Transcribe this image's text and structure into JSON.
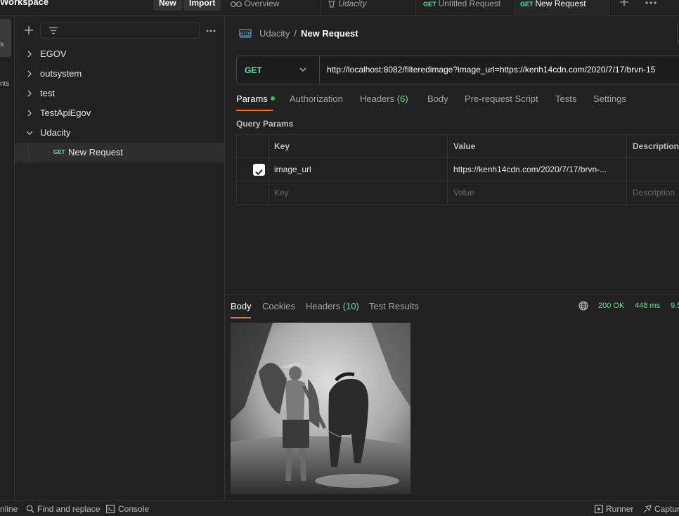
{
  "header": {
    "workspace_title": "Workspace",
    "new_label": "New",
    "import_label": "Import"
  },
  "tabs": [
    {
      "label": "Overview",
      "method": ""
    },
    {
      "label": "Udacity",
      "method": ""
    },
    {
      "label": "Untitled Request",
      "method": "GET"
    },
    {
      "label": "New Request",
      "method": "GET"
    }
  ],
  "rail": {
    "item1": "s",
    "item2": "nts"
  },
  "sidebar": {
    "items": [
      {
        "label": "EGOV",
        "expanded": false
      },
      {
        "label": "outsystem",
        "expanded": false
      },
      {
        "label": "test",
        "expanded": false
      },
      {
        "label": "TestApiEgov",
        "expanded": false
      },
      {
        "label": "Udacity",
        "expanded": true
      }
    ],
    "request": {
      "method": "GET",
      "label": "New Request"
    }
  },
  "request": {
    "breadcrumb_collection": "Udacity",
    "breadcrumb_separator": "/",
    "breadcrumb_name": "New Request",
    "method": "GET",
    "url": "http://localhost:8082/filteredimage?image_url=https://kenh14cdn.com/2020/7/17/brvn-15",
    "tabs": {
      "params": "Params",
      "authorization": "Authorization",
      "headers": "Headers",
      "headers_count": "(6)",
      "body": "Body",
      "prerequest": "Pre-request Script",
      "tests": "Tests",
      "settings": "Settings"
    },
    "query_params_title": "Query Params",
    "columns": {
      "key": "Key",
      "value": "Value",
      "description": "Description"
    },
    "params": [
      {
        "checked": true,
        "key": "image_url",
        "value": "https://kenh14cdn.com/2020/7/17/brvn-..."
      }
    ],
    "placeholder_row": {
      "key": "Key",
      "value": "Value",
      "description": "Description"
    }
  },
  "response": {
    "tabs": {
      "body": "Body",
      "cookies": "Cookies",
      "headers": "Headers",
      "headers_count": "(10)",
      "test_results": "Test Results"
    },
    "status": "200 OK",
    "time": "448 ms",
    "size": "9.5"
  },
  "statusbar": {
    "online": "nline",
    "find_replace": "Find and replace",
    "console": "Console",
    "runner": "Runner",
    "capture": "Captur"
  },
  "colors": {
    "accent": "#ff6c37",
    "success": "#6bdd9a",
    "background": "#212121"
  }
}
